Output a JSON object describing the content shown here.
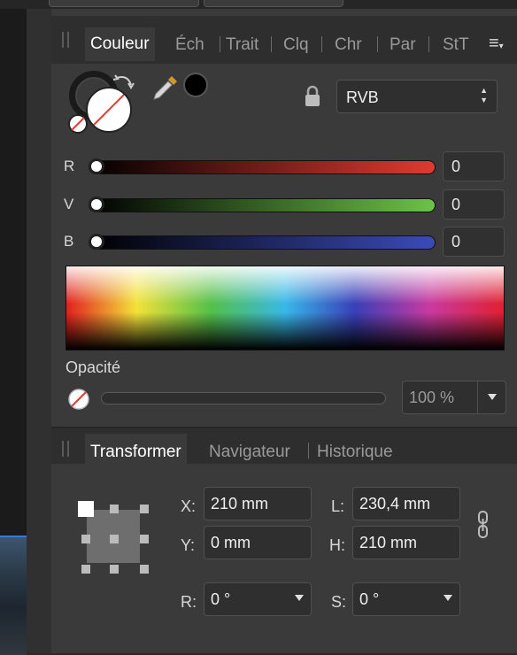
{
  "color_panel": {
    "tabs": [
      {
        "label": "Couleur",
        "active": true
      },
      {
        "label": "Éch",
        "active": false
      },
      {
        "label": "Trait",
        "active": false
      },
      {
        "label": "Clq",
        "active": false
      },
      {
        "label": "Chr",
        "active": false
      },
      {
        "label": "Par",
        "active": false
      },
      {
        "label": "StT",
        "active": false
      }
    ],
    "color_model": "RVB",
    "sliders": [
      {
        "label": "R",
        "value": "0",
        "color": "#e03a30"
      },
      {
        "label": "V",
        "value": "0",
        "color": "#6cc24a"
      },
      {
        "label": "B",
        "value": "0",
        "color": "#3a4bb8"
      }
    ],
    "opacity_label": "Opacité",
    "opacity_value": "100 %",
    "icons": [
      "swap-arrows-icon",
      "eyedropper-icon",
      "lock-icon",
      "panel-menu-icon",
      "no-fill-icon"
    ]
  },
  "transform_panel": {
    "tabs": [
      {
        "label": "Transformer",
        "active": true
      },
      {
        "label": "Navigateur",
        "active": false
      },
      {
        "label": "Historique",
        "active": false
      }
    ],
    "fields": {
      "x": {
        "label": "X:",
        "value": "210 mm"
      },
      "y": {
        "label": "Y:",
        "value": "0 mm"
      },
      "l": {
        "label": "L:",
        "value": "230,4 mm"
      },
      "h": {
        "label": "H:",
        "value": "210 mm"
      },
      "r": {
        "label": "R:",
        "value": "0 °"
      },
      "s": {
        "label": "S:",
        "value": "0 °"
      }
    },
    "icons": [
      "anchor-grid-icon",
      "link-icon"
    ]
  }
}
